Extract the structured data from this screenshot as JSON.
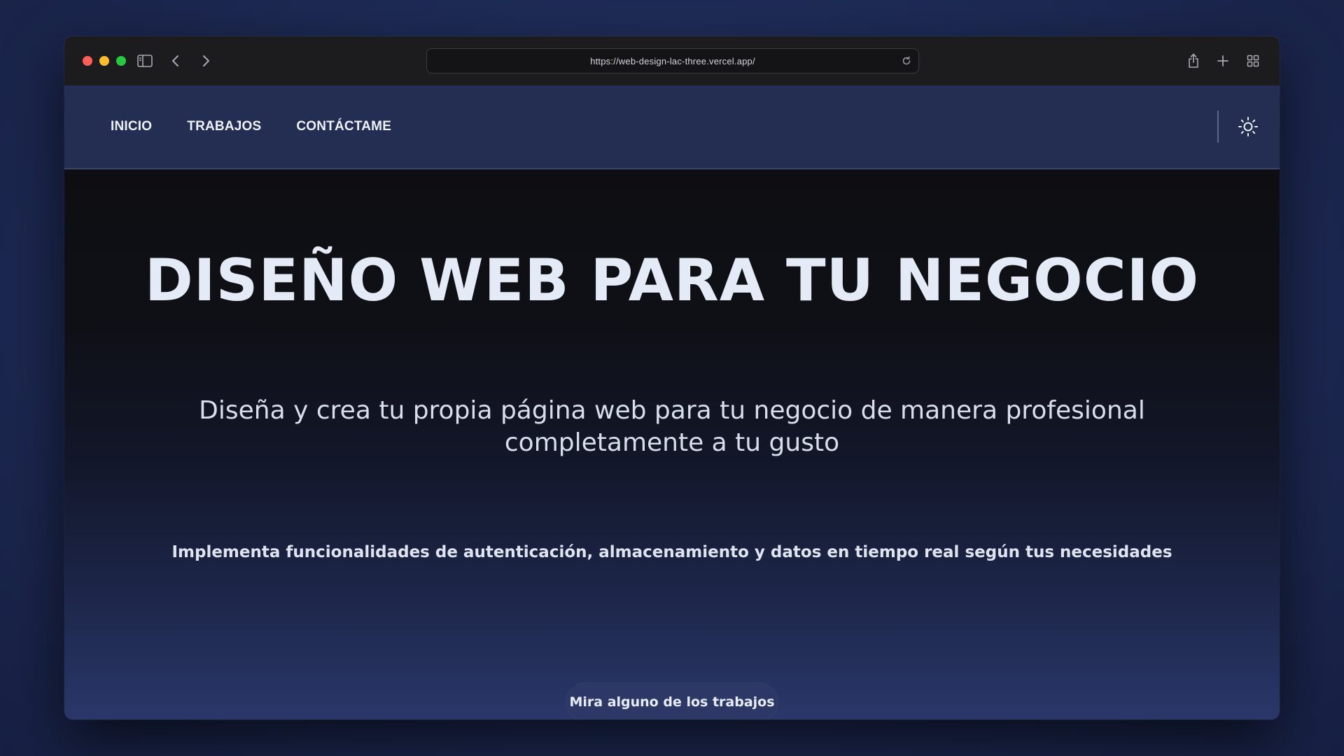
{
  "browser": {
    "url": "https://web-design-lac-three.vercel.app/",
    "icons": {
      "close": "close-dot",
      "minimize": "minimize-dot",
      "maximize": "maximize-dot",
      "sidebar": "sidebar-icon",
      "back": "chevron-left-icon",
      "forward": "chevron-right-icon",
      "reload": "reload-icon",
      "share": "share-icon",
      "new_tab": "plus-icon",
      "tab_overview": "grid-icon"
    }
  },
  "nav": {
    "links": [
      "INICIO",
      "TRABAJOS",
      "CONTÁCTAME"
    ],
    "theme_icon": "sun-icon"
  },
  "hero": {
    "title": "DISEÑO WEB PARA TU NEGOCIO",
    "subtitle": "Diseña y crea tu propia página web para tu negocio de manera profesional completamente a tu gusto",
    "description": "Implementa funcionalidades de autenticación, almacenamiento y datos en tiempo real según tus necesidades",
    "cta_label": "Mira alguno de los trabajos"
  },
  "colors": {
    "navbar": "#232e52",
    "hero_top": "#0e0e12",
    "hero_bottom": "#2a3769",
    "button": "#2d3866",
    "text": "#e5eaf7"
  }
}
